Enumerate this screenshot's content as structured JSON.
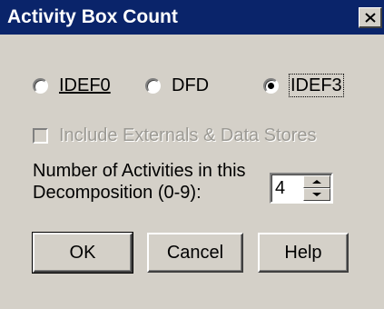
{
  "dialog": {
    "title": "Activity Box Count"
  },
  "radios": [
    {
      "label": "IDEF0",
      "checked": false
    },
    {
      "label": "DFD",
      "checked": false
    },
    {
      "label": "IDEF3",
      "checked": true
    }
  ],
  "checkbox": {
    "label": "Include Externals & Data Stores",
    "checked": false,
    "enabled": false
  },
  "activities": {
    "label_line1": "Number of Activities in this",
    "label_line2": "Decomposition (0-9):",
    "value": "4"
  },
  "buttons": {
    "ok": "OK",
    "cancel": "Cancel",
    "help": "Help"
  }
}
